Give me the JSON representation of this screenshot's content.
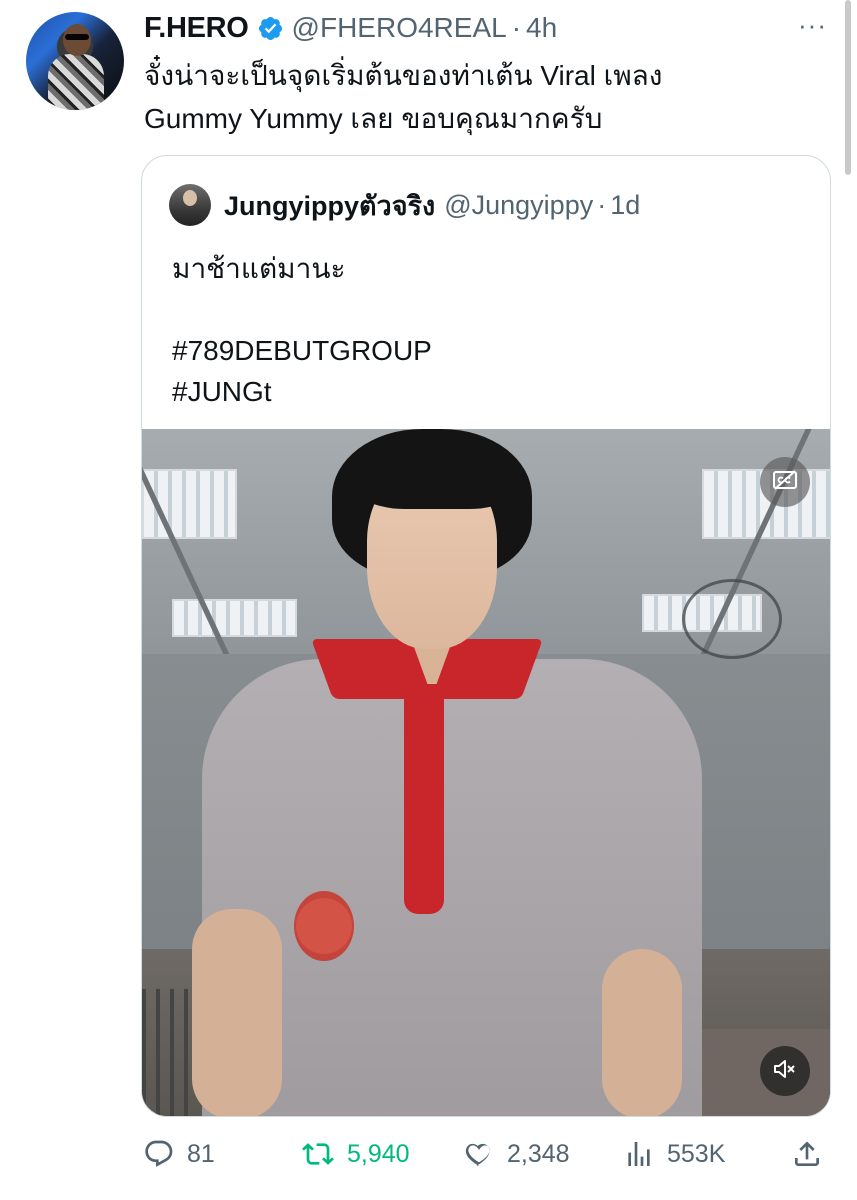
{
  "tweet": {
    "author": {
      "display_name": "F.HERO",
      "handle": "@FHERO4REAL",
      "verified": true
    },
    "separator": "·",
    "time": "4h",
    "more_label": "···",
    "text_lines": [
      "จั๋งน่าจะเป็นจุดเริ่มต้นของท่าเต้น Viral เพลง",
      "Gummy Yummy เลย ขอบคุณมากครับ"
    ]
  },
  "quote": {
    "author": {
      "display_name": "Jungyippyตัวจริง",
      "handle": "@Jungyippy"
    },
    "separator": "·",
    "time": "1d",
    "text_lines": [
      "มาช้าแต่มานะ",
      "",
      "#789DEBUTGROUP",
      "#JUNGt"
    ],
    "media": {
      "type": "video",
      "captions_icon": "closed-captions-off-icon",
      "mute_icon": "speaker-muted-icon"
    }
  },
  "actions": {
    "replies": "81",
    "retweets": "5,940",
    "likes": "2,348",
    "views": "553K",
    "retweet_active_color": "#00ba7c",
    "muted_color": "#536471"
  },
  "colors": {
    "verified_blue": "#1d9bf0",
    "text_primary": "#0f1419",
    "text_secondary": "#536471",
    "border": "#cfd9de"
  }
}
